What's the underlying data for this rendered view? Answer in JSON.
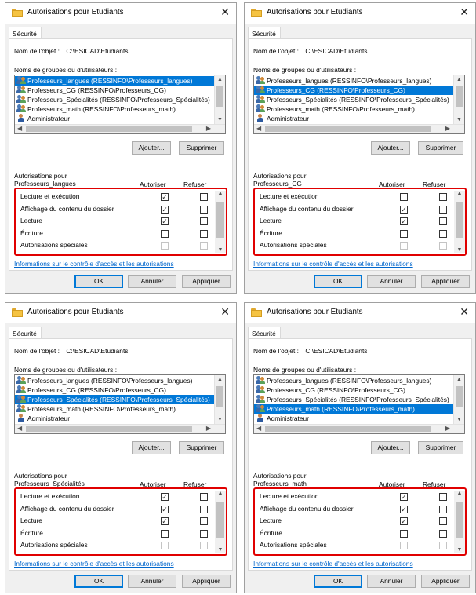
{
  "common": {
    "window_title": "Autorisations pour Etudiants",
    "close_glyph": "✕",
    "tab_label": "Sécurité",
    "object_name_label": "Nom de l'objet :",
    "object_name_value": "C:\\ESICAD\\Etudiants",
    "groups_label": "Noms de groupes ou d'utilisateurs :",
    "add_button": "Ajouter...",
    "remove_button": "Supprimer",
    "permissions_for_label": "Autorisations pour",
    "col_allow": "Autoriser",
    "col_deny": "Refuser",
    "info_link": "Informations sur le contrôle d'accès et les autorisations",
    "ok_button": "OK",
    "cancel_button": "Annuler",
    "apply_button": "Appliquer"
  },
  "groups": [
    {
      "label": "Professeurs_langues (RESSINFO\\Professeurs_langues)",
      "icon": "group-icon"
    },
    {
      "label": "Professeurs_CG (RESSINFO\\Professeurs_CG)",
      "icon": "group-icon"
    },
    {
      "label": "Professeurs_Spécialités (RESSINFO\\Professeurs_Spécialités)",
      "icon": "group-icon"
    },
    {
      "label": "Professeurs_math (RESSINFO\\Professeurs_math)",
      "icon": "group-icon"
    },
    {
      "label": "Administrateur",
      "icon": "user-icon"
    }
  ],
  "permissions": [
    "Lecture et exécution",
    "Affichage du contenu du dossier",
    "Lecture",
    "Écriture",
    "Autorisations spéciales"
  ],
  "dialogs": [
    {
      "selected_group_index": 0,
      "selected_name": "Professeurs_langues",
      "allow": [
        true,
        true,
        true,
        false,
        false
      ],
      "deny": [
        false,
        false,
        false,
        false,
        false
      ]
    },
    {
      "selected_group_index": 1,
      "selected_name": "Professeurs_CG",
      "allow": [
        false,
        true,
        true,
        false,
        false
      ],
      "deny": [
        false,
        false,
        false,
        false,
        false
      ]
    },
    {
      "selected_group_index": 2,
      "selected_name": "Professeurs_Spécialités",
      "allow": [
        true,
        true,
        true,
        false,
        false
      ],
      "deny": [
        false,
        false,
        false,
        false,
        false
      ]
    },
    {
      "selected_group_index": 3,
      "selected_name": "Professeurs_math",
      "allow": [
        true,
        true,
        true,
        false,
        false
      ],
      "deny": [
        false,
        false,
        false,
        false,
        false
      ]
    }
  ],
  "colors": {
    "selection": "#0078d7",
    "highlight_box": "#e00000",
    "link": "#0066cc"
  }
}
